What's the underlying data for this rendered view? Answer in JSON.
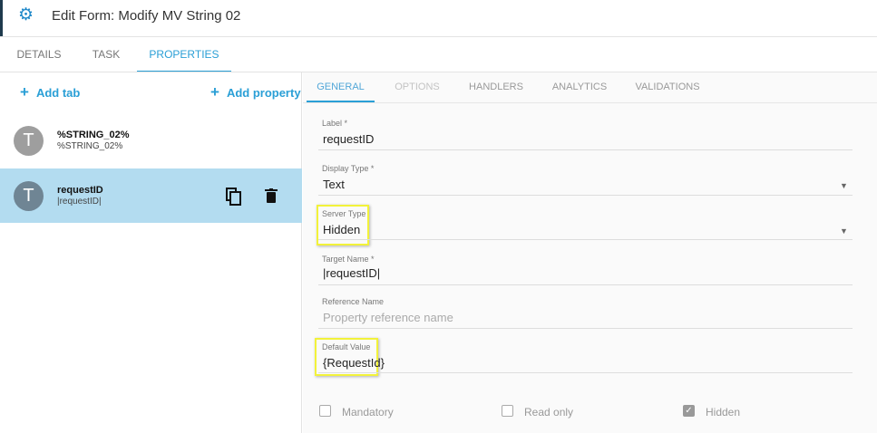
{
  "header": {
    "title": "Edit Form: Modify MV String 02",
    "icon": "gear-icon"
  },
  "tabs": [
    {
      "label": "DETAILS"
    },
    {
      "label": "TASK"
    },
    {
      "label": "PROPERTIES",
      "active": true
    }
  ],
  "left": {
    "add_tab": "Add tab",
    "add_property": "Add property",
    "items": [
      {
        "avatar": "T",
        "name": "%STRING_02%",
        "sub": "%STRING_02%",
        "avatar_color": "#9e9e9e"
      },
      {
        "avatar": "T",
        "name": "requestID",
        "sub": "|requestID|",
        "avatar_color": "#6f8594",
        "selected": true
      }
    ]
  },
  "inner_tabs": [
    {
      "label": "GENERAL"
    },
    {
      "label": "OPTIONS"
    },
    {
      "label": "HANDLERS"
    },
    {
      "label": "ANALYTICS"
    },
    {
      "label": "VALIDATIONS"
    }
  ],
  "fields": {
    "label": {
      "label": "Label *",
      "value": "requestID"
    },
    "display_type": {
      "label": "Display Type *",
      "value": "Text"
    },
    "server_type": {
      "label": "Server Type",
      "value": "Hidden"
    },
    "target_name": {
      "label": "Target Name *",
      "value": "|requestID|"
    },
    "reference_name": {
      "label": "Reference Name",
      "placeholder": "Property reference name"
    },
    "default_value": {
      "label": "Default Value",
      "value": "{RequestId}"
    }
  },
  "checkboxes": [
    {
      "label": "Mandatory",
      "checked": false
    },
    {
      "label": "Read only",
      "checked": false
    },
    {
      "label": "Hidden",
      "checked": true
    }
  ],
  "colors": {
    "accent": "#2a9fd6",
    "selected": "#b3dcf0",
    "highlight": "#f2f23a"
  }
}
